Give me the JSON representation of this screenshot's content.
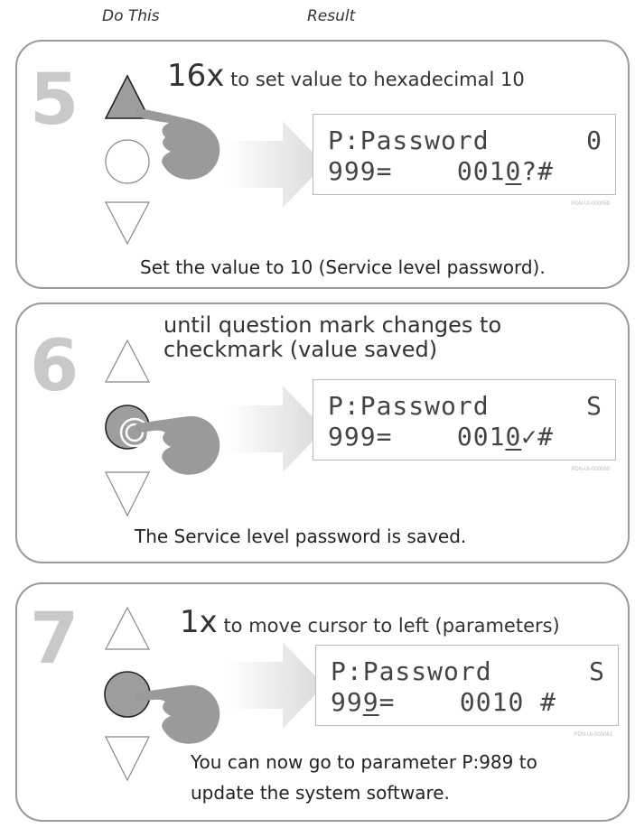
{
  "headers": {
    "do_this": "Do This",
    "result": "Result"
  },
  "steps": [
    {
      "number": "5",
      "instruction_count": "16x",
      "instruction_text": " to set value to hexadecimal 10",
      "active_button": "up",
      "lcd": {
        "line1_left": "P:Password",
        "line1_right": "0",
        "line2_prefix": "999=    001",
        "line2_cursor": "0",
        "line2_suffix": "?#",
        "tag": "PDN-UI-000059"
      },
      "caption": "Set the value to 10 (Service level password)."
    },
    {
      "number": "6",
      "instruction_line1": "until question mark changes to",
      "instruction_line2": "checkmark (value saved)",
      "active_button": "center-hold",
      "lcd": {
        "line1_left": "P:Password",
        "line1_right": "S",
        "line2_prefix": "999=    001",
        "line2_cursor": "0",
        "line2_suffix": "✓#",
        "tag": "PDN-UI-000060"
      },
      "caption": "The Service level password is saved."
    },
    {
      "number": "7",
      "instruction_count": "1x",
      "instruction_text": " to move cursor to left (parameters)",
      "active_button": "center",
      "lcd": {
        "line1_left": "P:Password",
        "line1_right": "S",
        "line2_prefix": "99",
        "line2_cursor": "9",
        "line2_suffix": "=    0010 #",
        "tag": "PDN-UI-000061"
      },
      "caption_line1": "You can now go to parameter P:989 to",
      "caption_line2": "update the system software."
    }
  ],
  "colors": {
    "panel_border": "#9a9a9a",
    "step_number": "#c9c9c9",
    "pressed_button": "#9e9e9e",
    "hand": "#9a9a9a"
  },
  "icons": [
    "up-button-icon",
    "center-button-icon",
    "down-button-icon",
    "hand-pointer-icon",
    "arrow-right-icon"
  ]
}
